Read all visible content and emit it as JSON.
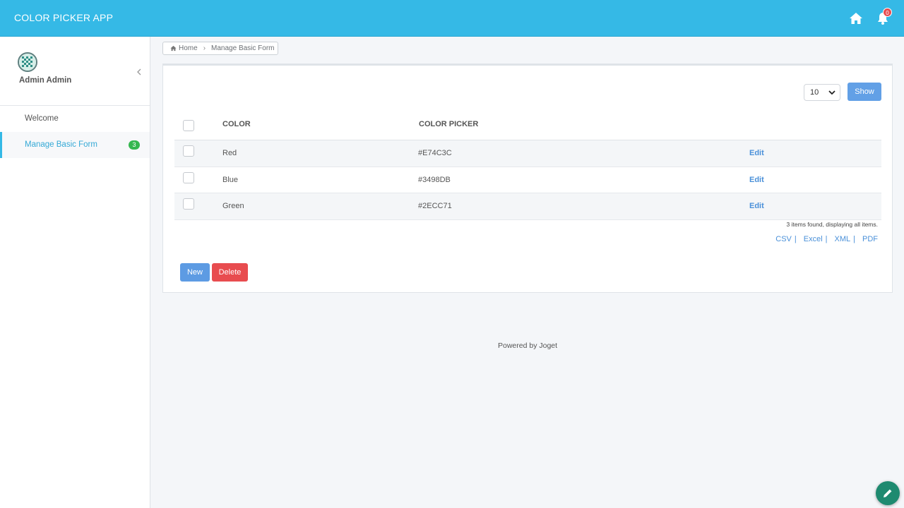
{
  "header": {
    "app_title": "COLOR PICKER APP",
    "icons": [
      "home-icon",
      "bell-icon"
    ],
    "notification_count": "0",
    "accent_color": "#35b9e6"
  },
  "sidebar": {
    "user_name": "Admin Admin",
    "items": [
      {
        "label": "Welcome"
      },
      {
        "label": "Manage Basic Form",
        "badge": "3",
        "active": true
      }
    ]
  },
  "breadcrumb": {
    "home": "Home",
    "current": "Manage Basic Form"
  },
  "list": {
    "page_size": "10",
    "show_label": "Show",
    "columns": [
      "COLOR",
      "COLOR PICKER"
    ],
    "rows": [
      {
        "color": "Red",
        "picker": "#E74C3C",
        "action": "Edit"
      },
      {
        "color": "Blue",
        "picker": "#3498DB",
        "action": "Edit"
      },
      {
        "color": "Green",
        "picker": "#2ECC71",
        "action": "Edit"
      }
    ],
    "found_text": "3 items found, displaying all items.",
    "exports": [
      "CSV",
      "Excel",
      "XML",
      "PDF"
    ],
    "new_label": "New",
    "delete_label": "Delete"
  },
  "footer": {
    "text": "Powered by Joget"
  }
}
